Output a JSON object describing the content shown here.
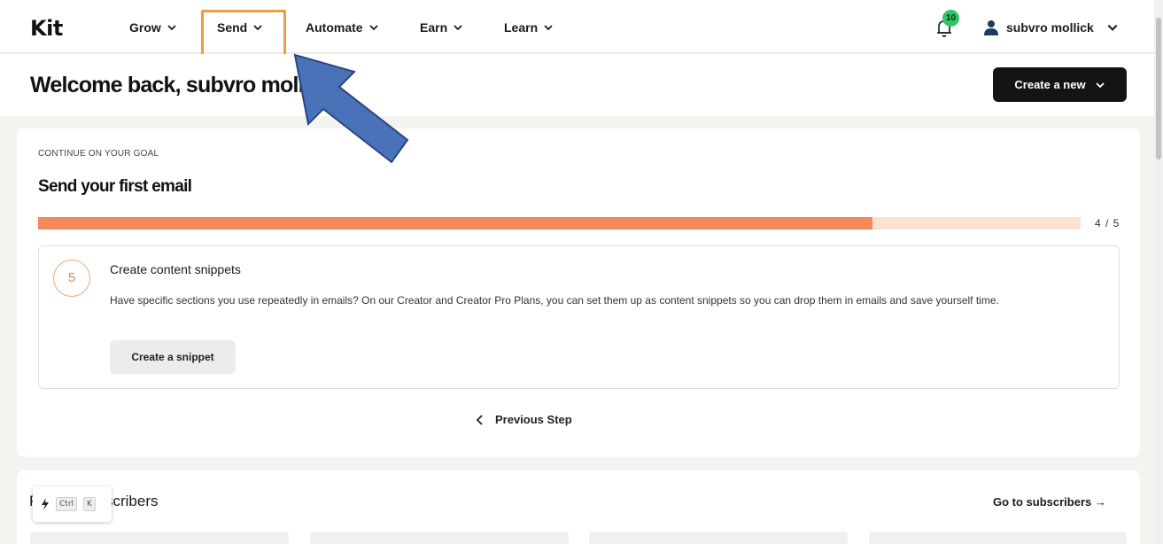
{
  "nav": {
    "logo": "Kit",
    "items": [
      {
        "label": "Grow"
      },
      {
        "label": "Send"
      },
      {
        "label": "Automate"
      },
      {
        "label": "Earn"
      },
      {
        "label": "Learn"
      }
    ],
    "notification_count": "10",
    "user_name": "subvro mollick"
  },
  "header": {
    "welcome": "Welcome back, subvro mollick",
    "create_new_label": "Create a new"
  },
  "goal": {
    "eyebrow": "CONTINUE ON YOUR GOAL",
    "title": "Send your first email",
    "progress_current": 4,
    "progress_total": 5,
    "progress_label": "4 / 5",
    "step": {
      "number": "5",
      "title": "Create content snippets",
      "description": "Have specific sections you use repeatedly in emails? On our Creator and Creator Pro Plans, you can set them up as content snippets so you can drop them in emails and save yourself time.",
      "button_label": "Create a snippet"
    },
    "previous_step_label": "Previous Step"
  },
  "subscribers": {
    "title": "Recent subscribers",
    "link_label": "Go to subscribers →"
  },
  "shortcut": {
    "key1": "Ctrl",
    "key2": "K"
  },
  "colors": {
    "accent_orange": "#f5895a",
    "progress_track": "#fde2d2",
    "highlight_box": "#f39c3f",
    "annotation_arrow": "#4a72b8",
    "badge_green": "#33c46a"
  }
}
